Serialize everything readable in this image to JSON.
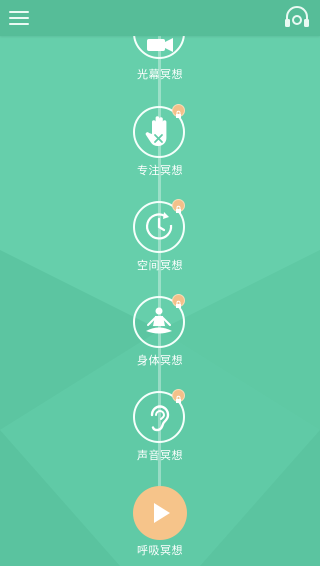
{
  "topbar": {
    "menu_icon": "hamburger-menu-icon",
    "headset_icon": "headset-icon"
  },
  "colors": {
    "background": "#62cca8",
    "topbar": "#56bd98",
    "lock_badge": "#f3c08a",
    "play_button": "#f6c48a"
  },
  "meditations": [
    {
      "label": "光幕冥想",
      "icon": "video-camera-icon",
      "locked": false
    },
    {
      "label": "专注冥想",
      "icon": "hand-stop-icon",
      "locked": true
    },
    {
      "label": "空间冥想",
      "icon": "clock-icon",
      "locked": true
    },
    {
      "label": "身体冥想",
      "icon": "meditation-pose-icon",
      "locked": true
    },
    {
      "label": "声音冥想",
      "icon": "ear-icon",
      "locked": true
    },
    {
      "label": "呼吸冥想",
      "icon": "play-icon",
      "locked": false
    }
  ]
}
